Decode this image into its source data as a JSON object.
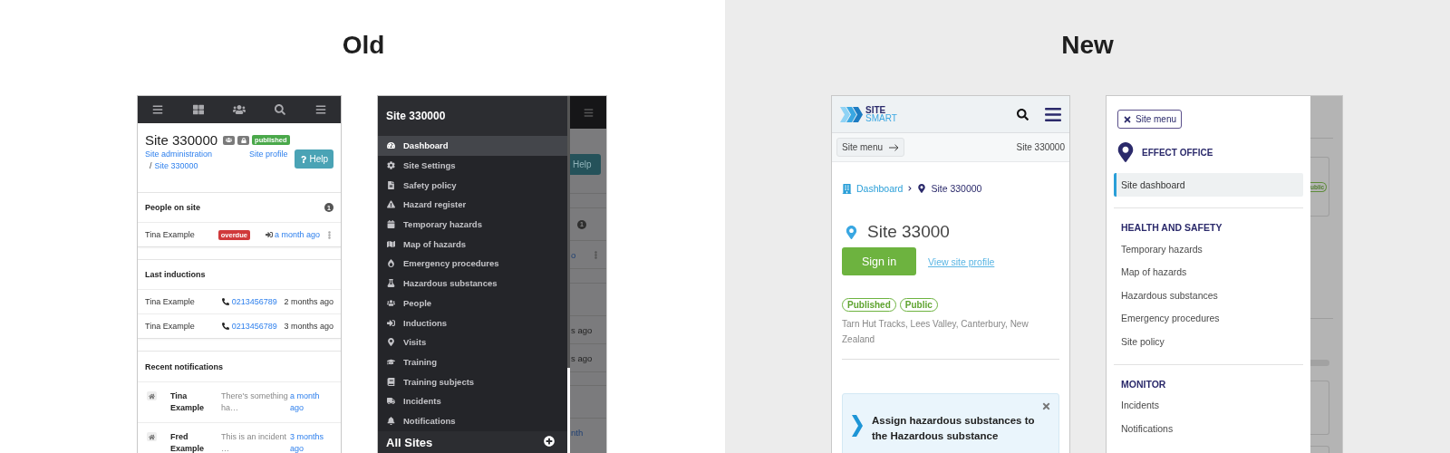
{
  "old": {
    "heading": "Old",
    "dashboard": {
      "title": "Site 330000",
      "status": "published",
      "admin_link": "Site administration",
      "crumb_separator": "/",
      "crumb_link": "Site 330000",
      "profile_link": "Site profile",
      "help_button": "Help",
      "people_on_site": {
        "title": "People on site",
        "count": "1",
        "rows": [
          {
            "name": "Tina Example",
            "status": "overdue",
            "time": "a month ago"
          }
        ]
      },
      "last_inductions": {
        "title": "Last inductions",
        "rows": [
          {
            "name": "Tina Example",
            "phone": "0213456789",
            "time": "2 months ago"
          },
          {
            "name": "Tina Example",
            "phone": "0213456789",
            "time": "3 months ago"
          }
        ]
      },
      "recent_notifications": {
        "title": "Recent notifications",
        "rows": [
          {
            "name": "Tina Example",
            "message": "There's something ha…",
            "time": "a month ago"
          },
          {
            "name": "Fred Example",
            "message": "This is an incident …",
            "time": "3 months ago"
          }
        ]
      }
    },
    "menu": {
      "title": "Site 330000",
      "items": [
        {
          "label": "Dashboard",
          "selected": true
        },
        {
          "label": "Site Settings",
          "selected": false
        },
        {
          "label": "Safety policy",
          "selected": false
        },
        {
          "label": "Hazard register",
          "selected": false
        },
        {
          "label": "Temporary hazards",
          "selected": false
        },
        {
          "label": "Map of hazards",
          "selected": false
        },
        {
          "label": "Emergency procedures",
          "selected": false
        },
        {
          "label": "Hazardous substances",
          "selected": false
        },
        {
          "label": "People",
          "selected": false
        },
        {
          "label": "Inductions",
          "selected": false
        },
        {
          "label": "Visits",
          "selected": false
        },
        {
          "label": "Training",
          "selected": false
        },
        {
          "label": "Training subjects",
          "selected": false
        },
        {
          "label": "Incidents",
          "selected": false
        },
        {
          "label": "Notifications",
          "selected": false
        }
      ],
      "footer": "All Sites",
      "backdrop": {
        "help": "Help",
        "count": "1",
        "link": "o",
        "times": [
          "s ago",
          "s ago"
        ],
        "bottom": "nth"
      }
    }
  },
  "new": {
    "heading": "New",
    "dashboard": {
      "logo": [
        "SITE",
        "SMART"
      ],
      "site_menu_button": "Site menu",
      "site_label": "Site 330000",
      "breadcrumb": [
        "Dashboard",
        "Site 330000"
      ],
      "title": "Site 33000",
      "sign_in_button": "Sign in",
      "profile_link": "View site profile",
      "tags": [
        "Published",
        "Public"
      ],
      "address": "Tarn Hut Tracks, Lees Valley, Canterbury, New Zealand",
      "notice": "Assign hazardous substances to the Hazardous substance"
    },
    "menu": {
      "close_button": "Site menu",
      "organisation": "EFFECT OFFICE",
      "items": [
        {
          "label": "Site dashboard",
          "selected": true
        }
      ],
      "sections": [
        {
          "title": "HEALTH AND SAFETY",
          "items": [
            {
              "label": "Temporary hazards",
              "selected": false
            },
            {
              "label": "Map of hazards",
              "selected": false
            },
            {
              "label": "Hazardous substances",
              "selected": false
            },
            {
              "label": "Emergency procedures",
              "selected": false
            },
            {
              "label": "Site policy",
              "selected": false
            }
          ]
        },
        {
          "title": "MONITOR",
          "items": [
            {
              "label": "Incidents",
              "selected": false
            },
            {
              "label": "Notifications",
              "selected": false
            }
          ]
        }
      ],
      "backdrop": {
        "tag": "ublic"
      }
    }
  }
}
